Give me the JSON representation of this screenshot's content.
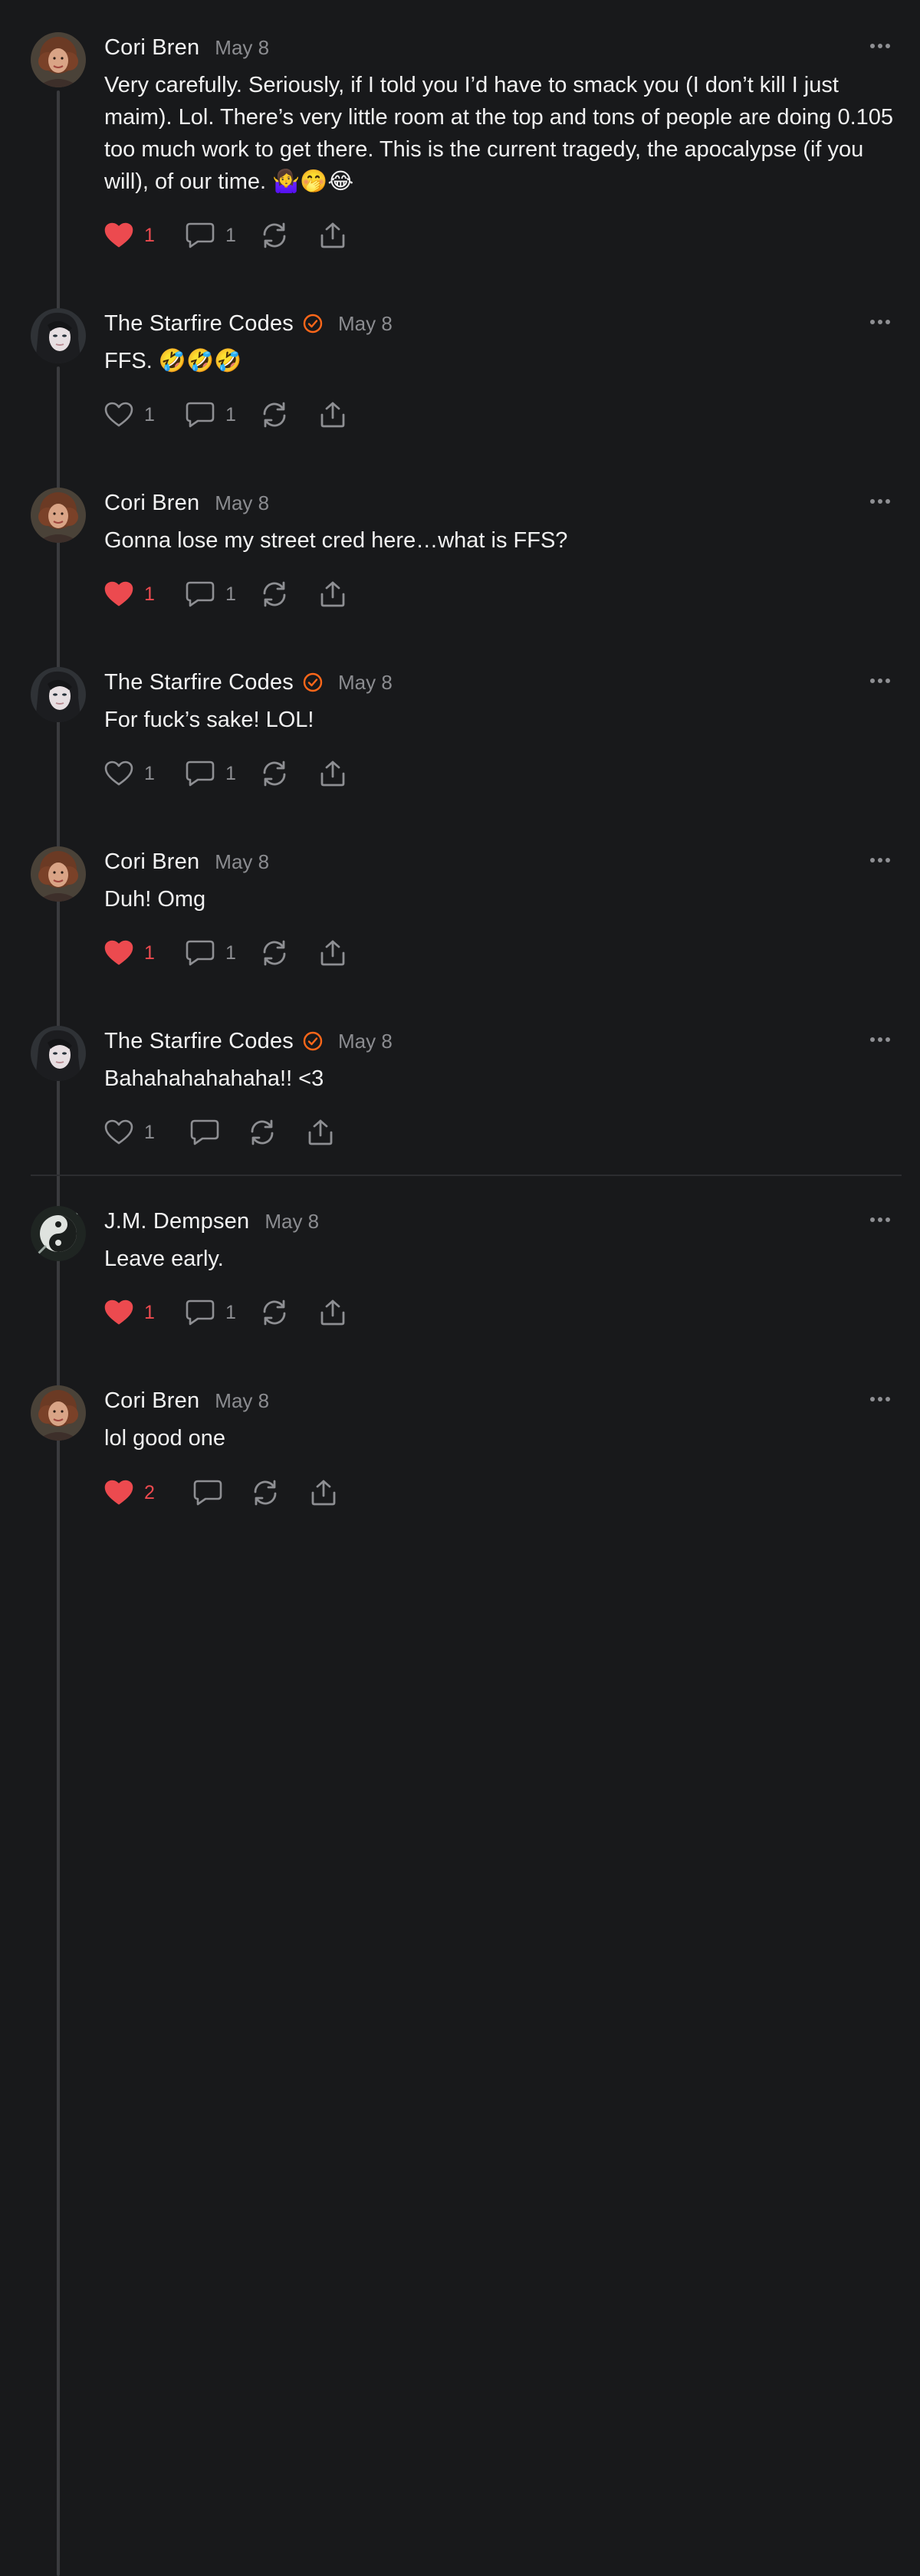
{
  "thread": {
    "posts": [
      {
        "author": "Cori Bren",
        "date": "May 8",
        "verified": false,
        "avatar": "cori-avatar",
        "text": "Very carefully. Seriously, if I told you I’d have to smack you (I don’t kill I just maim). Lol. There’s very little room at the top and tons of people are doing 0.105 too much work to get there. This is the current tragedy, the apocalypse (if you will), of our time. 🤷‍♀️🤭😂",
        "liked": true,
        "likes": "1",
        "replies": "1"
      },
      {
        "author": "The Starfire Codes",
        "date": "May 8",
        "verified": true,
        "avatar": "starfire-avatar",
        "text": "FFS. 🤣🤣🤣",
        "liked": false,
        "likes": "1",
        "replies": "1"
      },
      {
        "author": "Cori Bren",
        "date": "May 8",
        "verified": false,
        "avatar": "cori-avatar",
        "text": "Gonna lose my street cred here…what is FFS?",
        "liked": true,
        "likes": "1",
        "replies": "1"
      },
      {
        "author": "The Starfire Codes",
        "date": "May 8",
        "verified": true,
        "avatar": "starfire-avatar",
        "text": "For fuck’s sake! LOL!",
        "liked": false,
        "likes": "1",
        "replies": "1"
      },
      {
        "author": "Cori Bren",
        "date": "May 8",
        "verified": false,
        "avatar": "cori-avatar",
        "text": "Duh! Omg",
        "liked": true,
        "likes": "1",
        "replies": "1"
      },
      {
        "author": "The Starfire Codes",
        "date": "May 8",
        "verified": true,
        "avatar": "starfire-avatar",
        "text": "Bahahahahahaha!! <3",
        "liked": false,
        "likes": "1",
        "replies": ""
      },
      {
        "author": "J.M. Dempsen",
        "date": "May 8",
        "verified": false,
        "avatar": "dempsen-avatar",
        "text": "Leave early.",
        "liked": true,
        "likes": "1",
        "replies": "1"
      },
      {
        "author": "Cori Bren",
        "date": "May 8",
        "verified": false,
        "avatar": "cori-avatar",
        "text": "lol good one",
        "liked": true,
        "likes": "2",
        "replies": ""
      }
    ]
  },
  "icons": {
    "like": "heart-icon",
    "reply": "comment-bubble-icon",
    "restack": "restack-icon",
    "share": "share-icon",
    "more": "more-dots-icon",
    "verified": "verified-check-icon"
  },
  "colors": {
    "background": "#18191b",
    "text": "#f1f1f1",
    "muted": "#8b8c90",
    "like_active": "#ec4a4f",
    "verified": "#ff6719",
    "thread_line": "#3a3b3e"
  }
}
